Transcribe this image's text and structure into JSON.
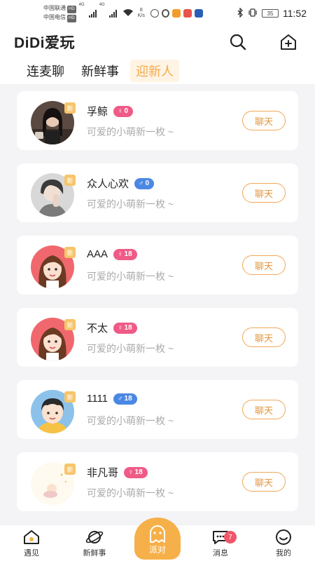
{
  "status_bar": {
    "carrier1": "中国联通",
    "carrier2": "中国电信",
    "hd": "HD",
    "net1": "4G",
    "net2": "4G",
    "speed_value": "8",
    "speed_unit": "K/s",
    "battery": "35",
    "time": "11:52"
  },
  "header": {
    "title": "DiDi爱玩",
    "search_icon": "search-icon",
    "add_icon": "house-plus-icon"
  },
  "tabs": [
    {
      "label": "连麦聊",
      "active": false
    },
    {
      "label": "新鲜事",
      "active": false
    },
    {
      "label": "迎新人",
      "active": true
    }
  ],
  "new_tag": "新",
  "chat_label": "聊天",
  "users": [
    {
      "name": "孚鲸",
      "gender": "female",
      "age": "0",
      "bio": "可爱的小萌新一枚 ~",
      "avatar": "photo-woman"
    },
    {
      "name": "众人心欢",
      "gender": "male",
      "age": "0",
      "bio": "可爱的小萌新一枚 ~",
      "avatar": "photo-man"
    },
    {
      "name": "AAA",
      "gender": "female",
      "age": "18",
      "bio": "可爱的小萌新一枚 ~",
      "avatar": "cartoon-girl"
    },
    {
      "name": "不太",
      "gender": "female",
      "age": "18",
      "bio": "可爱的小萌新一枚 ~",
      "avatar": "cartoon-girl"
    },
    {
      "name": "1111",
      "gender": "male",
      "age": "18",
      "bio": "可爱的小萌新一枚 ~",
      "avatar": "cartoon-boy"
    },
    {
      "name": "非凡哥",
      "gender": "female",
      "age": "18",
      "bio": "可爱的小萌新一枚 ~",
      "avatar": "moon-baby"
    }
  ],
  "bottom_nav": [
    {
      "label": "遇见",
      "icon": "home-icon"
    },
    {
      "label": "新鲜事",
      "icon": "planet-icon"
    },
    {
      "label": "派对",
      "icon": "ghost-icon"
    },
    {
      "label": "消息",
      "icon": "message-icon",
      "badge": "7"
    },
    {
      "label": "我的",
      "icon": "smile-icon"
    }
  ],
  "colors": {
    "accent": "#f3a94a",
    "female": "#ef5b86",
    "male": "#4b88e4",
    "badge": "#f0566a"
  }
}
